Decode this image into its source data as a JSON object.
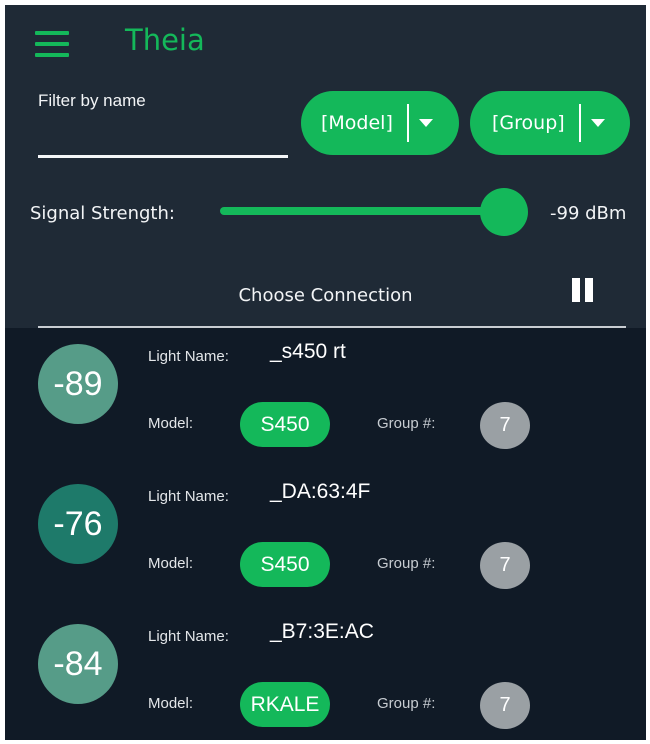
{
  "app": {
    "title": "Theia",
    "menu_icon": "hamburger-menu-icon"
  },
  "filter": {
    "label": "Filter by name",
    "value": ""
  },
  "dropdowns": {
    "model": {
      "label": "[Model]",
      "icon": "caret-down-icon"
    },
    "group": {
      "label": "[Group]",
      "icon": "caret-down-icon"
    }
  },
  "signal": {
    "label": "Signal Strength:",
    "value_text": "-99 dBm",
    "slider_fraction": 0.98
  },
  "list_header": {
    "title": "Choose Connection",
    "pause_icon": "pause-icon"
  },
  "field_labels": {
    "light_name": "Light Name:",
    "model": "Model:",
    "group": "Group #:"
  },
  "colors": {
    "accent": "#14b85a",
    "background": "#1f2a36",
    "list_background": "#101a26",
    "group_chip": "#9aa0a4",
    "rssi_light": "#569c88",
    "rssi_dark": "#1e7a6a"
  },
  "connections": [
    {
      "rssi": "-89",
      "rssi_color": "#569c88",
      "name": "_s450 rt",
      "model": "S450",
      "group": "7"
    },
    {
      "rssi": "-76",
      "rssi_color": "#1e7a6a",
      "name": "_DA:63:4F",
      "model": "S450",
      "group": "7"
    },
    {
      "rssi": "-84",
      "rssi_color": "#569c88",
      "name": "_B7:3E:AC",
      "model": "RKALE",
      "group": "7"
    }
  ]
}
